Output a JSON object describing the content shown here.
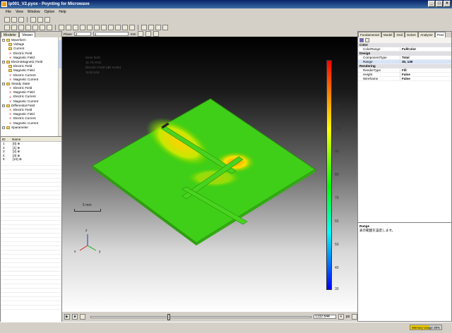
{
  "window": {
    "title": "lp001_V2.pyox - Poynting for Microwave"
  },
  "menu": [
    "File",
    "View",
    "Window",
    "Option",
    "Help"
  ],
  "left_tabs": [
    "Modeler",
    "Viewer"
  ],
  "tree": [
    {
      "label": "Waveform",
      "kind": "folder",
      "level": 0
    },
    {
      "label": "Voltage",
      "kind": "folder",
      "level": 1
    },
    {
      "label": "Current",
      "kind": "folder",
      "level": 1
    },
    {
      "label": "Electric Field",
      "kind": "x",
      "level": 1
    },
    {
      "label": "Magnetic Field",
      "kind": "x",
      "level": 1
    },
    {
      "label": "ElectroMagnetic Field",
      "kind": "folder",
      "level": 0
    },
    {
      "label": "Electric Field",
      "kind": "folder",
      "level": 1
    },
    {
      "label": "Magnetic Field",
      "kind": "folder",
      "level": 1
    },
    {
      "label": "Electric Current",
      "kind": "x",
      "level": 1
    },
    {
      "label": "Magnetic Current",
      "kind": "x",
      "level": 1
    },
    {
      "label": "Steady State",
      "kind": "folder",
      "level": 0
    },
    {
      "label": "Electric Field",
      "kind": "x",
      "level": 1
    },
    {
      "label": "Magnetic Field",
      "kind": "x",
      "level": 1
    },
    {
      "label": "Electric Current",
      "kind": "x",
      "level": 1
    },
    {
      "label": "Magnetic Current",
      "kind": "x",
      "level": 1
    },
    {
      "label": "Differential Field",
      "kind": "folder",
      "level": 0
    },
    {
      "label": "Electric Field",
      "kind": "x",
      "level": 1
    },
    {
      "label": "Magnetic Field",
      "kind": "x",
      "level": 1
    },
    {
      "label": "Electric Current",
      "kind": "x",
      "level": 1
    },
    {
      "label": "Magnetic Current",
      "kind": "x",
      "level": 1
    },
    {
      "label": "Sparameter",
      "kind": "folder",
      "level": 0
    }
  ],
  "list": {
    "headers": [
      "ID",
      "Name"
    ],
    "rows": [
      {
        "id": "1",
        "name": "[0] ⊕"
      },
      {
        "id": "2",
        "name": "[1] ⊕"
      },
      {
        "id": "3",
        "name": "[2] ⊕"
      },
      {
        "id": "4",
        "name": "[3] ⊕"
      },
      {
        "id": "5",
        "name": "[10] ⊕"
      }
    ]
  },
  "viewport_bar": {
    "plane_label": "Plane",
    "plane_value": "Z",
    "coord_value": "0",
    "unit": "mm"
  },
  "viewport": {
    "info_lines": [
      "Near field",
      "11.75 GHz",
      "Electric Field (dB scale)",
      "1132.644"
    ],
    "scale_label": "5 mm",
    "colorbar_ticks": [
      "120",
      "110",
      "100",
      "90",
      "80",
      "70",
      "60",
      "50",
      "40",
      "30"
    ],
    "axes": {
      "z": "z",
      "y": "y",
      "x": "x"
    }
  },
  "bottom_bar": {
    "value": "1132.644",
    "unit": "ps"
  },
  "right_tabs": [
    "Fundamental",
    "Model",
    "Grid",
    "Solver",
    "Analyzer",
    "Post"
  ],
  "properties": [
    {
      "category": "Color",
      "rows": [
        {
          "key": "ColorRange",
          "value": "FullColor"
        }
      ]
    },
    {
      "category": "Design",
      "rows": [
        {
          "key": "ComponentType",
          "value": "Total"
        },
        {
          "key": "Range",
          "value": "30, 130",
          "selected": true
        }
      ]
    },
    {
      "category": "Rendering",
      "rows": [
        {
          "key": "RenderType",
          "value": "Fill"
        },
        {
          "key": "Height",
          "value": "False"
        },
        {
          "key": "Wireframe",
          "value": "False"
        }
      ]
    }
  ],
  "description": {
    "title": "Range",
    "text": "表示範囲を設定します。"
  },
  "status": {
    "memory": "Memory Usage 39%"
  }
}
